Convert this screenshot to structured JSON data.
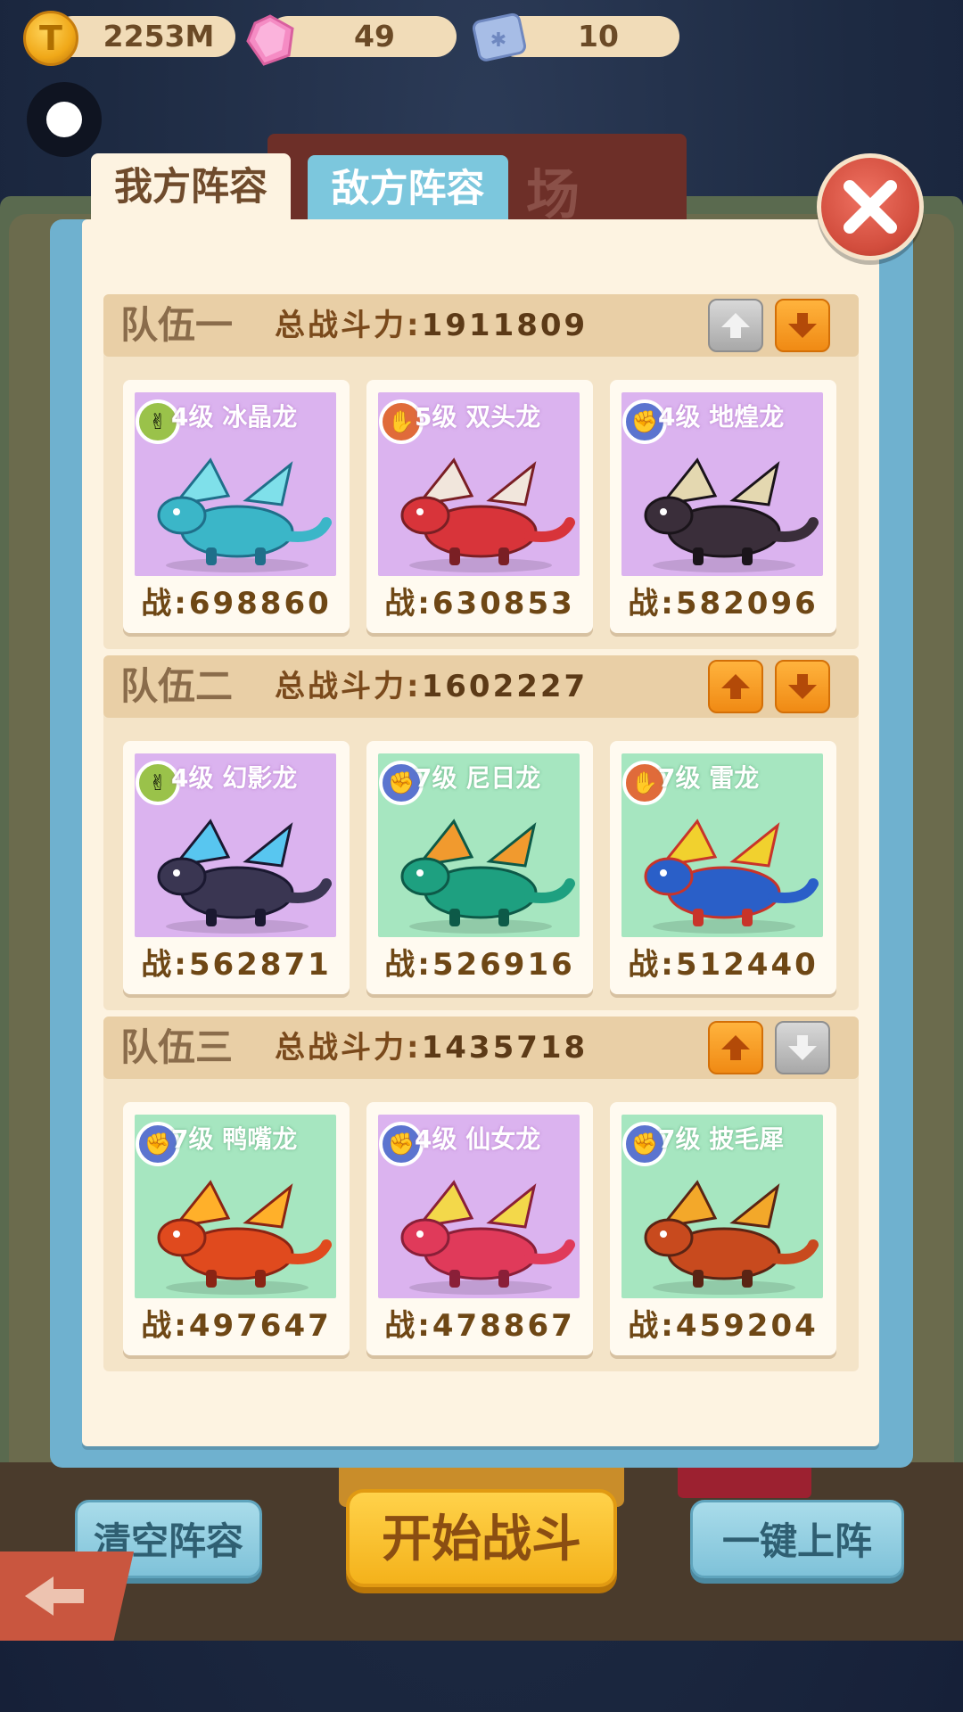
{
  "resources": {
    "coins": "2253M",
    "gems": "49",
    "tickets": "10"
  },
  "background_title": "场",
  "tabs": {
    "mine": "我方阵容",
    "enemy": "敌方阵容"
  },
  "power_label": "总战斗力:",
  "card_power_prefix": "战:",
  "teams": [
    {
      "name": "队伍一",
      "total_power": "1911809",
      "up_enabled": false,
      "down_enabled": true,
      "cards": [
        {
          "level_name": "4级 冰晶龙",
          "power": "战:698860",
          "element": "scissors",
          "bg": "purple"
        },
        {
          "level_name": "5级 双头龙",
          "power": "战:630853",
          "element": "paper",
          "bg": "purple"
        },
        {
          "level_name": "4级 地煌龙",
          "power": "战:582096",
          "element": "rock",
          "bg": "purple"
        }
      ]
    },
    {
      "name": "队伍二",
      "total_power": "1602227",
      "up_enabled": true,
      "down_enabled": true,
      "cards": [
        {
          "level_name": "4级 幻影龙",
          "power": "战:562871",
          "element": "scissors",
          "bg": "purple"
        },
        {
          "level_name": "7级 尼日龙",
          "power": "战:526916",
          "element": "rock",
          "bg": "green"
        },
        {
          "level_name": "7级 雷龙",
          "power": "战:512440",
          "element": "paper",
          "bg": "green"
        }
      ]
    },
    {
      "name": "队伍三",
      "total_power": "1435718",
      "up_enabled": true,
      "down_enabled": false,
      "cards": [
        {
          "level_name": "7级 鸭嘴龙",
          "power": "战:497647",
          "element": "rock",
          "bg": "green"
        },
        {
          "level_name": "4级 仙女龙",
          "power": "战:478867",
          "element": "rock",
          "bg": "purple"
        },
        {
          "level_name": "7级 披毛犀",
          "power": "战:459204",
          "element": "rock",
          "bg": "green"
        }
      ]
    }
  ],
  "buttons": {
    "clear": "清空阵容",
    "start": "开始战斗",
    "auto": "一键上阵"
  },
  "colors": {
    "purple_card": "#dbb3ef",
    "green_card": "#a6e6c0",
    "orange_button": "#f5a126",
    "gray_button": "#b8b8b8",
    "enemy_tab": "#7cc7dd"
  }
}
